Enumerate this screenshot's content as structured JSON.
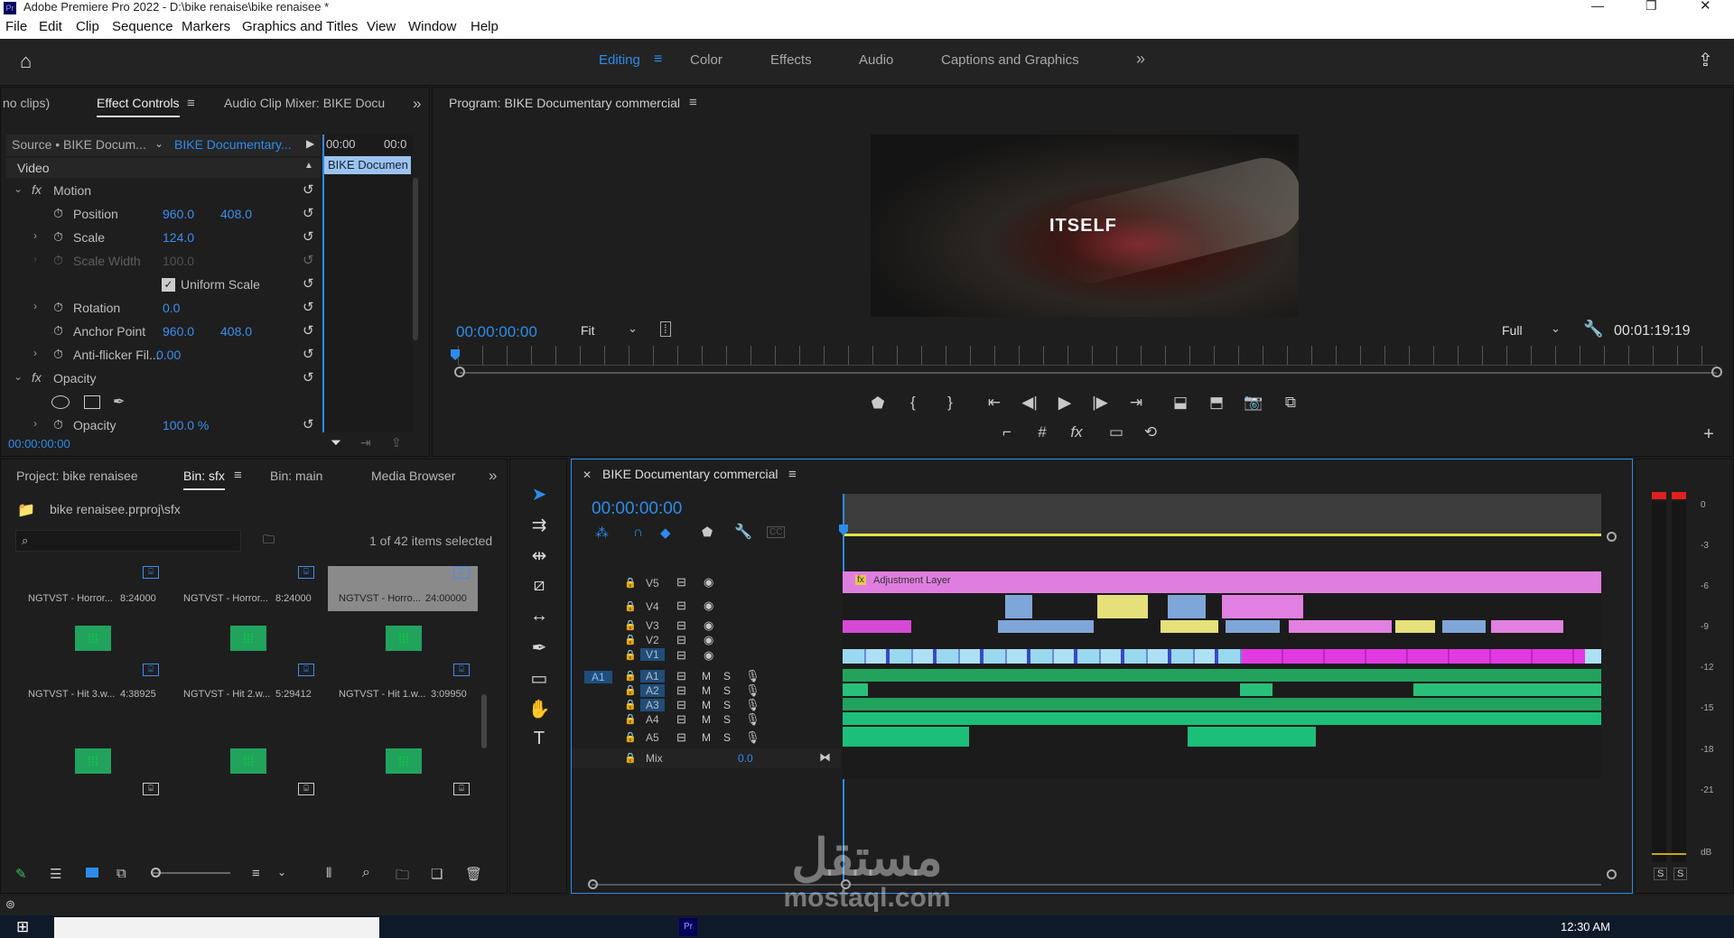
{
  "window": {
    "title": "Adobe Premiere Pro 2022 - D:\\bike renaise\\bike renaisee *"
  },
  "menu": [
    "File",
    "Edit",
    "Clip",
    "Sequence",
    "Markers",
    "Graphics and Titles",
    "View",
    "Window",
    "Help"
  ],
  "workspaces": {
    "editing": "Editing",
    "color": "Color",
    "effects": "Effects",
    "audio": "Audio",
    "captions": "Captions and Graphics",
    "more": "»"
  },
  "source_panel": {
    "tab_noclips": "no clips)",
    "tab_effect_controls": "Effect Controls",
    "tab_audio_mixer": "Audio Clip Mixer: BIKE Docu",
    "more": "»",
    "source_label": "Source • BIKE Docum...",
    "sequence_label": "BIKE Documentary...",
    "tc_start": "00:00",
    "tc_end": "00:0",
    "clip_bar": "BIKE Documen",
    "section_video": "Video",
    "current_tc": "00:00:00:00"
  },
  "effect_rows": [
    {
      "name": "Motion",
      "v1": "",
      "v2": ""
    },
    {
      "name": "Position",
      "v1": "960.0",
      "v2": "408.0"
    },
    {
      "name": "Scale",
      "v1": "124.0",
      "v2": ""
    },
    {
      "name": "Scale Width",
      "v1": "100.0",
      "v2": ""
    },
    {
      "name": "Uniform Scale",
      "v1": "",
      "v2": ""
    },
    {
      "name": "Rotation",
      "v1": "0.0",
      "v2": ""
    },
    {
      "name": "Anchor Point",
      "v1": "960.0",
      "v2": "408.0"
    },
    {
      "name": "Anti-flicker Fil...",
      "v1": "0.00",
      "v2": ""
    },
    {
      "name": "Opacity",
      "v1": "",
      "v2": ""
    },
    {
      "name": "Opacity",
      "v1": "100.0 %",
      "v2": ""
    }
  ],
  "program": {
    "title": "Program: BIKE Documentary commercial",
    "frame_text": "ITSELF",
    "tc_current": "00:00:00:00",
    "fit": "Fit",
    "quality": "Full",
    "tc_duration": "00:01:19:19"
  },
  "project": {
    "tab_project": "Project: bike renaisee",
    "tab_bin_sfx": "Bin: sfx",
    "tab_bin_main": "Bin: main",
    "tab_media_browser": "Media Browser",
    "more": "»",
    "path": "bike renaisee.prproj\\sfx",
    "items_selected": "1 of 42 items selected",
    "tiles": [
      {
        "name": "NGTVST - Horror...",
        "dur": "8:24000"
      },
      {
        "name": "NGTVST - Horror...",
        "dur": "8:24000"
      },
      {
        "name": "NGTVST - Horro...",
        "dur": "24:00000"
      },
      {
        "name": "NGTVST - Hit 3.w...",
        "dur": "4:38925"
      },
      {
        "name": "NGTVST - Hit 2.w...",
        "dur": "5:29412"
      },
      {
        "name": "NGTVST - Hit 1.w...",
        "dur": "3:09950"
      },
      {
        "name": "",
        "dur": ""
      },
      {
        "name": "",
        "dur": ""
      },
      {
        "name": "",
        "dur": ""
      }
    ]
  },
  "timeline": {
    "title": "BIKE Documentary commercial",
    "tc": "00:00:00:00",
    "adjustment_layer": "Adjustment Layer",
    "video_tracks": [
      "V5",
      "V4",
      "V3",
      "V2",
      "V1"
    ],
    "audio_tracks": [
      "A1",
      "A2",
      "A3",
      "A4",
      "A5"
    ],
    "source_patch": "A1",
    "mix_label": "Mix",
    "mix_value": "0.0",
    "m": "M",
    "s": "S"
  },
  "meter": {
    "ticks": [
      "0",
      "-3",
      "-6",
      "-9",
      "-12",
      "-15",
      "-18",
      "-21",
      "dB"
    ],
    "solo_left": "S",
    "solo_right": "S"
  },
  "taskbar": {
    "time": "12:30 AM"
  },
  "watermark": {
    "arabic": "مستقل",
    "latin": "mostaql.com"
  },
  "colors": {
    "accent": "#2d8ceb",
    "adjustment": "#e07ee0",
    "audio_green": "#21a35d",
    "v_yellow": "#e6e07a",
    "v_pink": "#e080e0",
    "v_blue": "#7fa6d8"
  }
}
